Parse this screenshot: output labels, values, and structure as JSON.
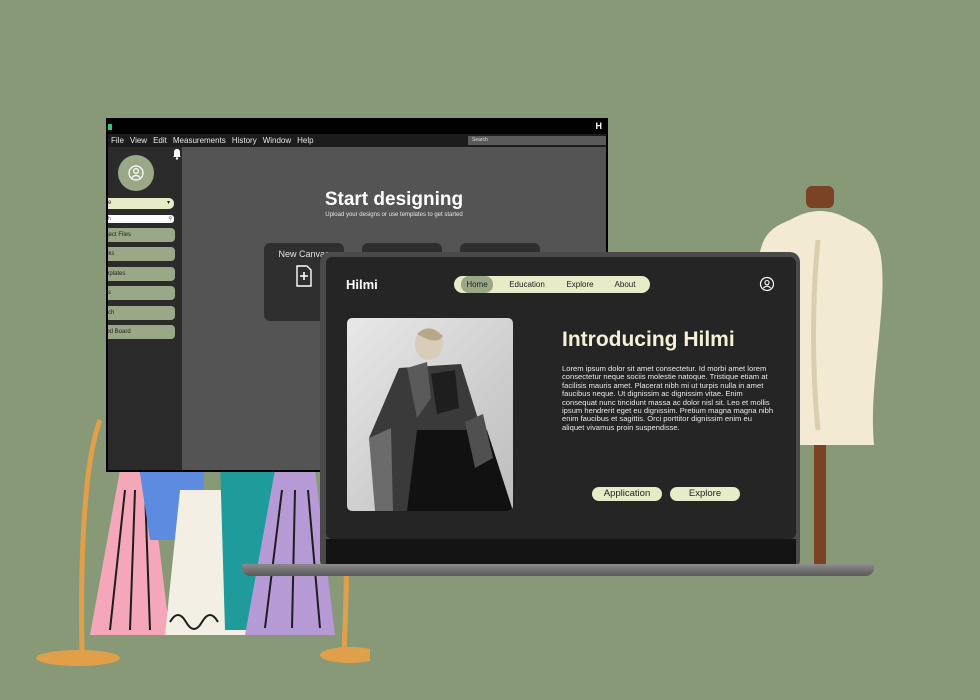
{
  "desktop_app": {
    "window_icon": "H",
    "menu": [
      "File",
      "View",
      "Edit",
      "Measurements",
      "History",
      "Window",
      "Help"
    ],
    "search_placeholder": "Search",
    "bell_icon": "bell-icon",
    "avatar_icon": "user-circle-icon",
    "sidebar_dropdown": "e",
    "sidebar_search_placeholder": "h",
    "sidebar_items": [
      "Project Files",
      "Packs",
      "Templates",
      "s",
      "ch",
      "Mood Board"
    ],
    "start_title": "Start designing",
    "start_subtitle": "Upload your designs or use templates to get started",
    "cards": [
      {
        "label": "New Canvas",
        "icon": "new-file-icon"
      },
      {
        "label": "",
        "icon": ""
      },
      {
        "label": "",
        "icon": ""
      }
    ]
  },
  "website": {
    "brand": "Hilmi",
    "nav": [
      "Home",
      "Education",
      "Explore",
      "About"
    ],
    "active_nav": "Home",
    "account_icon": "user-circle-icon",
    "hero_title": "Introducing Hilmi",
    "hero_text": "Lorem ipsum dolor sit amet consectetur. Id morbi amet lorem consectetur neque sociis molestie natoque. Tristique etiam at facilisis mauris amet. Placerat nibh mi ut turpis nulla in amet faucibus neque. Ut dignissim ac dignissim vitae. Enim consequat nunc tincidunt massa ac dolor nisl sit. Leo et mollis ipsum hendrerit eget eu dignissim. Pretium magna magna nibh enim faucibus et sagittis. Orci porttitor dignissim enim eu aliquet vivamus proin suspendisse.",
    "buttons": [
      "Application",
      "Explore"
    ]
  },
  "colors": {
    "background": "#889977",
    "accent": "#e7ebc8",
    "sidebar_button": "#9aa888"
  }
}
